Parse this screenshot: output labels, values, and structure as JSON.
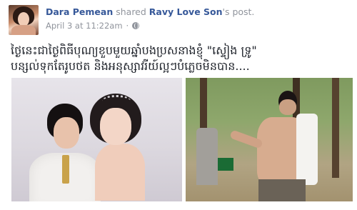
{
  "post": {
    "author": "Dara Pemean",
    "action_text": " shared ",
    "shared_from": "Ravy Love Son",
    "shared_suffix": "'s post.",
    "date": "April 3 at 11:22am",
    "separator": "·",
    "text_line1": "ថ្ងៃនេះជាថ្ងៃពិធីបុណ្យខួបមួយឆ្នាំបងប្រសនាងខ្ញុំ \"ស្ទៀង ទ្រូ\"",
    "text_line2": "បន្សល់ទុកតែរូបថត និងអនុស្សាវរីយ៍ល្អៗបំភ្លេចមិនបាន...."
  },
  "icons": {
    "privacy": "globe-icon"
  }
}
